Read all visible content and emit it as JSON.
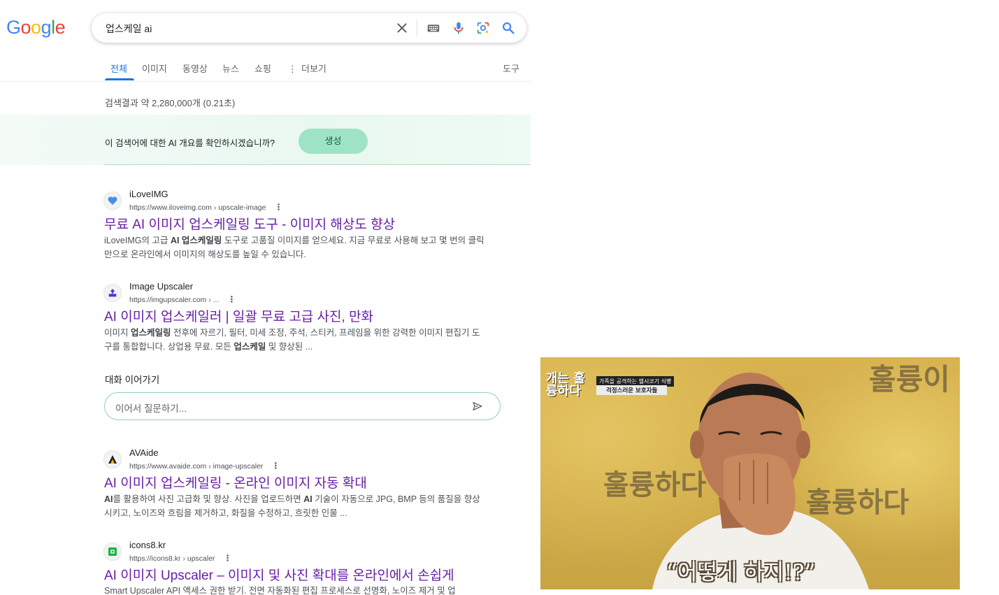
{
  "logo": {
    "text": "Google"
  },
  "search": {
    "query": "업스케일 ai"
  },
  "tabs": [
    {
      "label": "전체",
      "active": true
    },
    {
      "label": "이미지"
    },
    {
      "label": "동영상"
    },
    {
      "label": "뉴스"
    },
    {
      "label": "쇼핑"
    },
    {
      "label": "더보기"
    }
  ],
  "tools_label": "도구",
  "result_stats": "검색결과 약 2,280,000개 (0.21초)",
  "ai_overview": {
    "prompt": "이 검색어에 대한 AI 개요를 확인하시겠습니까?",
    "button": "생성"
  },
  "results": [
    {
      "site": "iLoveIMG",
      "url": "https://www.iloveimg.com › upscale-image",
      "title": "무료 AI 이미지 업스케일링 도구 - 이미지 해상도 향상",
      "snippet": "iLoveIMG의 고급 AI 업스케일링 도구로 고품질 이미지를 얻으세요. 지금 무료로 사용해 보고 몇 번의 클릭만으로 온라인에서 이미지의 해상도를 높일 수 있습니다.",
      "favicon": "heart-icon"
    },
    {
      "site": "Image Upscaler",
      "url": "https://imgupscaler.com › ...",
      "title": "AI 이미지 업스케일러 | 일괄 무료 고급 사진, 만화",
      "snippet": "이미지 업스케일링 전후에 자르기, 필터, 미세 조정, 주석, 스티커, 프레임을 위한 강력한 이미지 편집기 도구를 통합합니다. 상업용 무료. 모든 업스케일 및 향상된 ...",
      "favicon": "upscale-icon"
    },
    {
      "site": "AVAide",
      "url": "https://www.avaide.com › image-upscaler",
      "title": "AI 이미지 업스케일링 - 온라인 이미지 자동 확대",
      "snippet": "AI를 활용하여 사진 고급화 및 향상. 사진을 업로드하면 AI 기술이 자동으로 JPG, BMP 등의 품질을 향상시키고, 노이즈와 흐림을 제거하고, 화질을 수정하고, 흐릿한 인물 ...",
      "favicon": "avaide-logo-icon"
    },
    {
      "site": "icons8.kr",
      "url": "https://icons8.kr › upscaler",
      "title": "AI 이미지 Upscaler – 이미지 및 사진 확대를 온라인에서 손쉽게",
      "snippet": "Smart Upscaler API 액세스 권한 받기. 전면 자동화된 편집 프로세스로 선명화, 노이즈 제거 및 업",
      "favicon": "icons8-logo-icon"
    }
  ],
  "conversation": {
    "label": "대화 이어가기",
    "placeholder": "이어서 질문하기..."
  },
  "video": {
    "show_logo": "개는 훌륭하다",
    "caption_top": "가족을 공격하는 헬시코기 식빵",
    "caption_bottom": "걱정스러운 보호자들",
    "subtitle": "“어떻게 하지!?”"
  },
  "colors": {
    "link_visited": "#681da8",
    "tab_active": "#1a73e8",
    "generate_button": "#9fe3c6"
  }
}
